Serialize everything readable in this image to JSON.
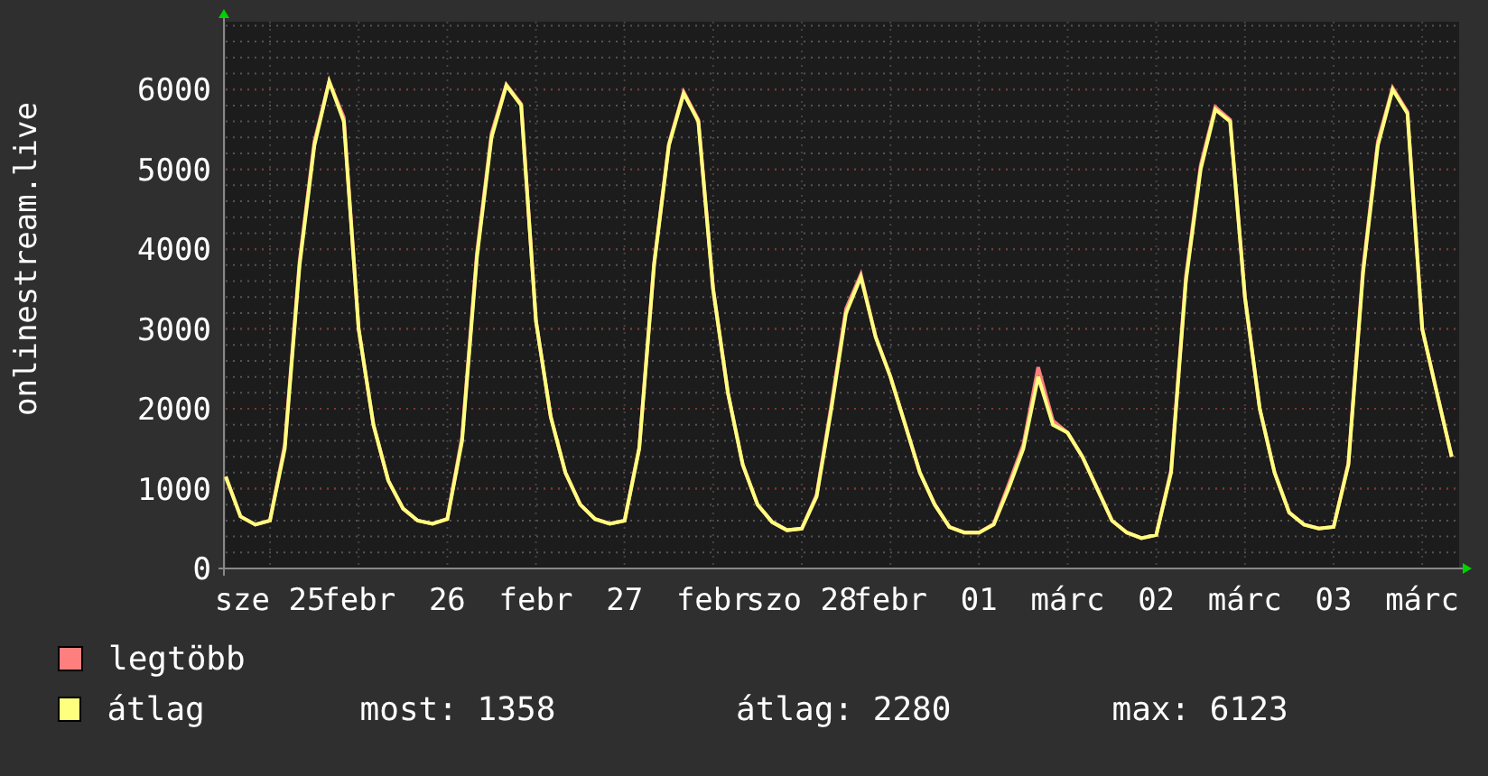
{
  "chart_data": {
    "type": "line",
    "grid": true,
    "ylabel": "onlinestream.live",
    "ylim": [
      0,
      6850
    ],
    "yticks": [
      0,
      1000,
      2000,
      3000,
      4000,
      5000,
      6000
    ],
    "categories": [
      null,
      null,
      null,
      "sze 25",
      null,
      null,
      null,
      null,
      null,
      "febr",
      null,
      null,
      null,
      null,
      null,
      "26",
      null,
      null,
      null,
      null,
      null,
      "febr",
      null,
      null,
      null,
      null,
      null,
      "27",
      null,
      null,
      null,
      null,
      null,
      "febr",
      null,
      null,
      null,
      null,
      null,
      "szo 28",
      null,
      null,
      null,
      null,
      null,
      "febr",
      null,
      null,
      null,
      null,
      null,
      "01",
      null,
      null,
      null,
      null,
      null,
      "márc",
      null,
      null,
      null,
      null,
      null,
      "02",
      null,
      null,
      null,
      null,
      null,
      "márc",
      null,
      null,
      null,
      null,
      null,
      "03",
      null,
      null,
      null,
      null,
      null,
      "márc",
      null,
      null
    ],
    "series": [
      {
        "name": "legtöbb",
        "color": "#ff7f7f",
        "values": [
          1150,
          650,
          550,
          600,
          1550,
          3850,
          5350,
          6100,
          5650,
          3000,
          1800,
          1100,
          750,
          600,
          560,
          620,
          1650,
          3950,
          5450,
          6060,
          5820,
          3100,
          1900,
          1200,
          800,
          620,
          560,
          600,
          1520,
          3820,
          5320,
          5970,
          5620,
          3500,
          2200,
          1300,
          800,
          580,
          480,
          500,
          920,
          2050,
          3250,
          3680,
          2900,
          2400,
          1800,
          1200,
          800,
          520,
          450,
          450,
          560,
          1050,
          1550,
          2520,
          1850,
          1700,
          1400,
          1000,
          600,
          450,
          380,
          420,
          1230,
          3650,
          5050,
          5780,
          5620,
          3400,
          2000,
          1200,
          700,
          550,
          500,
          520,
          1320,
          3750,
          5350,
          6020,
          5720,
          3000,
          2200,
          1400
        ]
      },
      {
        "name": "átlag",
        "color": "#ffff7f",
        "values": [
          1150,
          650,
          550,
          600,
          1500,
          3800,
          5300,
          6100,
          5600,
          3000,
          1800,
          1100,
          750,
          600,
          560,
          620,
          1600,
          3900,
          5400,
          6050,
          5800,
          3100,
          1900,
          1200,
          800,
          620,
          560,
          600,
          1500,
          3800,
          5300,
          5950,
          5600,
          3500,
          2200,
          1300,
          800,
          580,
          480,
          500,
          900,
          2000,
          3200,
          3650,
          2900,
          2400,
          1800,
          1200,
          800,
          520,
          450,
          450,
          550,
          1000,
          1500,
          2400,
          1800,
          1700,
          1400,
          1000,
          600,
          450,
          380,
          420,
          1200,
          3600,
          5000,
          5750,
          5600,
          3400,
          2000,
          1200,
          700,
          550,
          500,
          520,
          1300,
          3700,
          5300,
          6000,
          5700,
          3000,
          2200,
          1400
        ]
      }
    ]
  },
  "legend_stats": [
    "most: 1358",
    "átlag: 2280",
    "max: 6123"
  ]
}
